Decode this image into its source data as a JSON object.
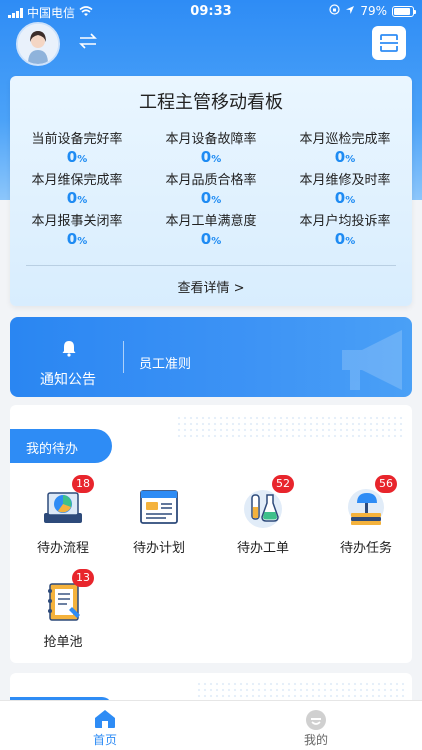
{
  "status_bar": {
    "carrier": "中国电信",
    "time": "09:33",
    "battery": "79%"
  },
  "colors": {
    "primary": "#2e8cf5",
    "metric_value": "#1e8bf3",
    "badge": "#e8252c"
  },
  "board": {
    "title": "工程主管移动看板",
    "metrics": [
      {
        "label": "当前设备完好率",
        "value": "0",
        "unit": "%"
      },
      {
        "label": "本月设备故障率",
        "value": "0",
        "unit": "%"
      },
      {
        "label": "本月巡检完成率",
        "value": "0",
        "unit": "%"
      },
      {
        "label": "本月维保完成率",
        "value": "0",
        "unit": "%"
      },
      {
        "label": "本月品质合格率",
        "value": "0",
        "unit": "%"
      },
      {
        "label": "本月维修及时率",
        "value": "0",
        "unit": "%"
      },
      {
        "label": "本月报事关闭率",
        "value": "0",
        "unit": "%"
      },
      {
        "label": "本月工单满意度",
        "value": "0",
        "unit": "%"
      },
      {
        "label": "本月户均投诉率",
        "value": "0",
        "unit": "%"
      }
    ],
    "detail_link": "查看详情 >"
  },
  "notice": {
    "label": "通知公告",
    "text": "员工准则"
  },
  "todo": {
    "title": "我的待办",
    "items": [
      {
        "name": "待办流程",
        "badge": "18",
        "icon": "process-chart-icon"
      },
      {
        "name": "待办计划",
        "badge": "",
        "icon": "plan-document-icon"
      },
      {
        "name": "待办工单",
        "badge": "52",
        "icon": "lab-flask-icon"
      },
      {
        "name": "待办任务",
        "badge": "56",
        "icon": "task-lamp-icon"
      },
      {
        "name": "抢单池",
        "badge": "13",
        "icon": "notebook-icon"
      }
    ]
  },
  "tabbar": {
    "home": "首页",
    "mine": "我的"
  }
}
